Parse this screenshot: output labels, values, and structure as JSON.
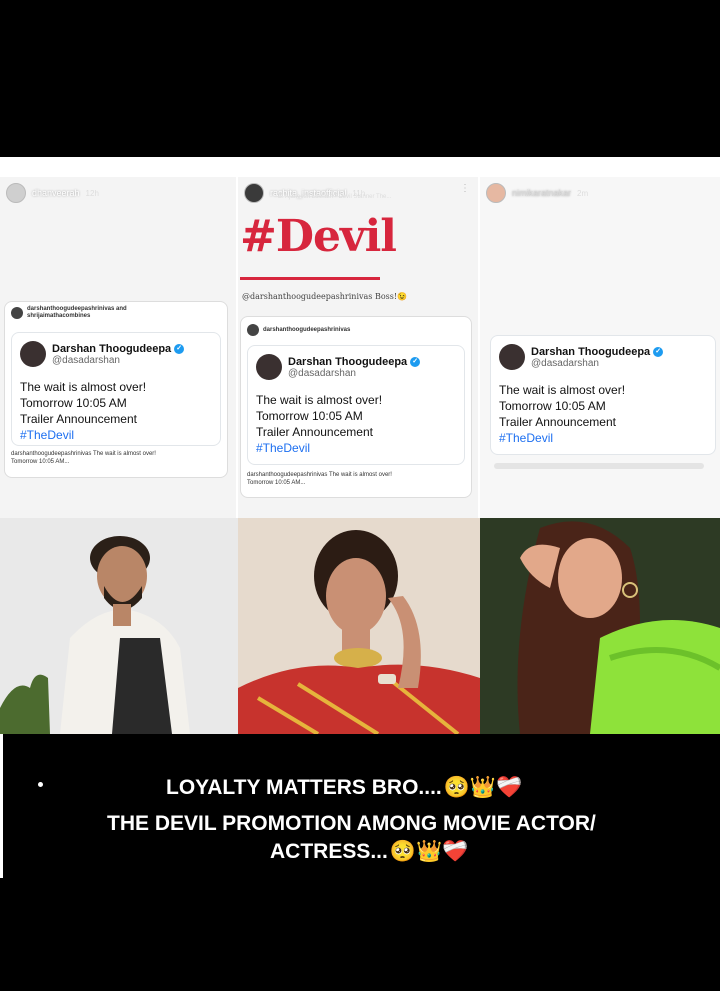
{
  "stories": [
    {
      "username": "dhanveerah",
      "time": "12h",
      "post_owner": "darshanthoogudeepashrinivas and shrijaimathacombines",
      "tweet": {
        "name": "Darshan Thoogudeepa",
        "handle": "@dasadarshan",
        "line1": "The wait is almost over!",
        "line2": "Tomorrow  10:05 AM",
        "line3": "Trailer Announcement",
        "hashtag": "#TheDevil"
      },
      "foot_line1": "darshanthoogudeepashrinivas The wait is almost over!",
      "foot_line2": "Tomorrow  10:05 AM..."
    },
    {
      "username": "rachita_instaofficial",
      "time": "11h",
      "subline": "B. Ajaneesh Loknath • Devil Stanner The...",
      "title": "#Devil",
      "caption": "@darshanthoogudeepashrinivas Boss!😉",
      "post_owner": "darshanthoogudeepashrinivas",
      "tweet": {
        "name": "Darshan Thoogudeepa",
        "handle": "@dasadarshan",
        "line1": "The wait is almost over!",
        "line2": "Tomorrow  10:05 AM",
        "line3": "Trailer Announcement",
        "hashtag": "#TheDevil"
      },
      "foot_line1": "darshanthoogudeepashrinivas The wait is almost over!",
      "foot_line2": "Tomorrow  10:05 AM..."
    },
    {
      "username": "nimikaratnakar",
      "time": "2m",
      "tweet": {
        "name": "Darshan Thoogudeepa",
        "handle": "@dasadarshan",
        "line1": "The wait is almost over!",
        "line2": "Tomorrow  10:05 AM",
        "line3": "Trailer Announcement",
        "hashtag": "#TheDevil"
      }
    }
  ],
  "caption": {
    "line1": "LOYALTY MATTERS BRO....",
    "line1_emoji": "🥺👑❤️‍🩹",
    "line2": "THE DEVIL PROMOTION AMONG MOVIE ACTOR/",
    "line3": "ACTRESS...",
    "line3_emoji": "🥺👑❤️‍🩹"
  },
  "colors": {
    "devil_red": "#d7263d",
    "verified_blue": "#1d9bf0",
    "hashtag_blue": "#1d6ff0",
    "saree_green": "#8ee23a",
    "saree_red": "#c7332d"
  }
}
